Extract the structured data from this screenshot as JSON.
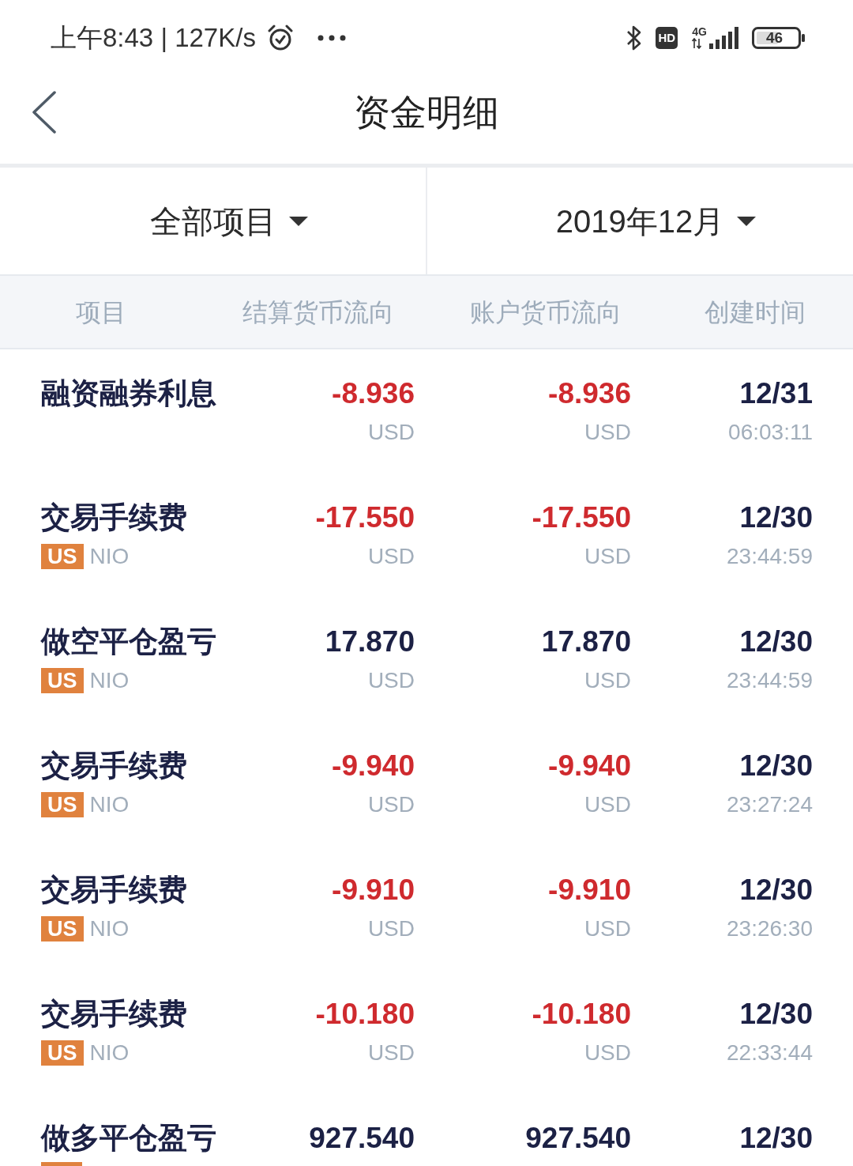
{
  "status_bar": {
    "time_speed": "上午8:43 | 127K/s",
    "hd_badge": "HD",
    "network": "4G",
    "battery": "46"
  },
  "header": {
    "title": "资金明细"
  },
  "filters": [
    {
      "label": "全部项目"
    },
    {
      "label": "2019年12月"
    }
  ],
  "table": {
    "columns": [
      "项目",
      "结算货币流向",
      "账户货币流向",
      "创建时间"
    ],
    "rows": [
      {
        "name": "融资融券利息",
        "negative": true,
        "settlement": {
          "amount": "-8.936",
          "currency": "USD"
        },
        "account": {
          "amount": "-8.936",
          "currency": "USD"
        },
        "date": "12/31",
        "time": "06:03:11"
      },
      {
        "name": "交易手续费",
        "tag": "US",
        "symbol": "NIO",
        "negative": true,
        "settlement": {
          "amount": "-17.550",
          "currency": "USD"
        },
        "account": {
          "amount": "-17.550",
          "currency": "USD"
        },
        "date": "12/30",
        "time": "23:44:59"
      },
      {
        "name": "做空平仓盈亏",
        "tag": "US",
        "symbol": "NIO",
        "negative": false,
        "settlement": {
          "amount": "17.870",
          "currency": "USD"
        },
        "account": {
          "amount": "17.870",
          "currency": "USD"
        },
        "date": "12/30",
        "time": "23:44:59"
      },
      {
        "name": "交易手续费",
        "tag": "US",
        "symbol": "NIO",
        "negative": true,
        "settlement": {
          "amount": "-9.940",
          "currency": "USD"
        },
        "account": {
          "amount": "-9.940",
          "currency": "USD"
        },
        "date": "12/30",
        "time": "23:27:24"
      },
      {
        "name": "交易手续费",
        "tag": "US",
        "symbol": "NIO",
        "negative": true,
        "settlement": {
          "amount": "-9.910",
          "currency": "USD"
        },
        "account": {
          "amount": "-9.910",
          "currency": "USD"
        },
        "date": "12/30",
        "time": "23:26:30"
      },
      {
        "name": "交易手续费",
        "tag": "US",
        "symbol": "NIO",
        "negative": true,
        "settlement": {
          "amount": "-10.180",
          "currency": "USD"
        },
        "account": {
          "amount": "-10.180",
          "currency": "USD"
        },
        "date": "12/30",
        "time": "22:33:44"
      },
      {
        "name": "做多平仓盈亏",
        "tag_clipped": true,
        "negative": false,
        "settlement": {
          "amount": "927.540"
        },
        "account": {
          "amount": "927.540"
        },
        "date": "12/30"
      }
    ]
  }
}
